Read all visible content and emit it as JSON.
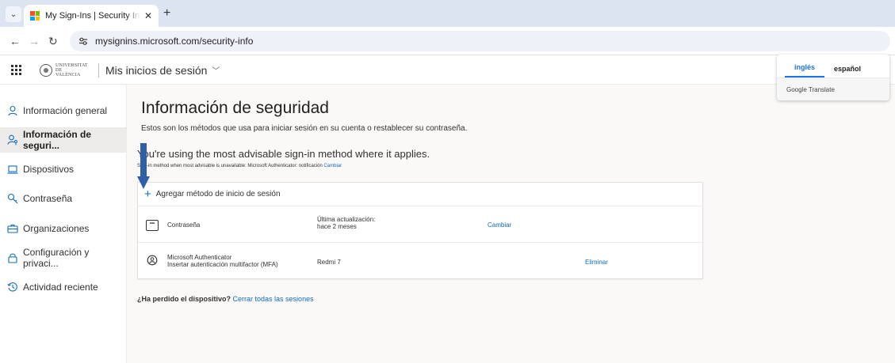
{
  "browser": {
    "tab_title": "My Sign-Ins | Security Info | Microsoft",
    "tab_close": "✕",
    "new_tab": "+",
    "url": "mysignins.microsoft.com/security-info"
  },
  "header": {
    "university_logo_text": "UNIVERSITAT DE VALÈNCIA",
    "app_title": "Mis inicios de sesión"
  },
  "sidebar": {
    "items": [
      {
        "label": "Información general",
        "icon": "person-icon",
        "active": false
      },
      {
        "label": "Información de seguri...",
        "icon": "person-key-icon",
        "active": true
      },
      {
        "label": "Dispositivos",
        "icon": "laptop-icon",
        "active": false
      },
      {
        "label": "Contraseña",
        "icon": "key-icon",
        "active": false
      },
      {
        "label": "Organizaciones",
        "icon": "briefcase-icon",
        "active": false
      },
      {
        "label": "Configuración y privaci...",
        "icon": "lock-icon",
        "active": false
      },
      {
        "label": "Actividad reciente",
        "icon": "history-icon",
        "active": false
      }
    ]
  },
  "main": {
    "title": "Información de seguridad",
    "description": "Estos son los métodos que usa para iniciar sesión en su cuenta o restablecer su contraseña.",
    "advice": "You're using the most advisable sign-in method where it applies.",
    "default_method_text": "Sign-in method when most advisable is unavailable: Microsoft Authenticator: notificación",
    "default_method_link": "Cambiar",
    "add_method_label": "Agregar método de inicio de sesión",
    "methods": [
      {
        "icon": "password-icon",
        "name": "Contraseña",
        "subname": "",
        "detail_line1": "Última actualización:",
        "detail_line2": "hace 2 meses",
        "action": "Cambiar"
      },
      {
        "icon": "authenticator-icon",
        "name": "Microsoft Authenticator",
        "subname": "Insertar autenticación multifactor (MFA)",
        "detail_line1": "Redmi 7",
        "detail_line2": "",
        "action": "Eliminar"
      }
    ],
    "lost_device_question": "¿Ha perdido el dispositivo?",
    "lost_device_link": "Cerrar todas las sesiones"
  },
  "translate_popup": {
    "tabs": [
      "inglés",
      "español"
    ],
    "active_tab": 0,
    "footer": "Google Translate"
  },
  "colors": {
    "accent": "#0f6cbd",
    "annotation_arrow": "#2f5fa8",
    "tabstrip": "#dce4f2"
  }
}
